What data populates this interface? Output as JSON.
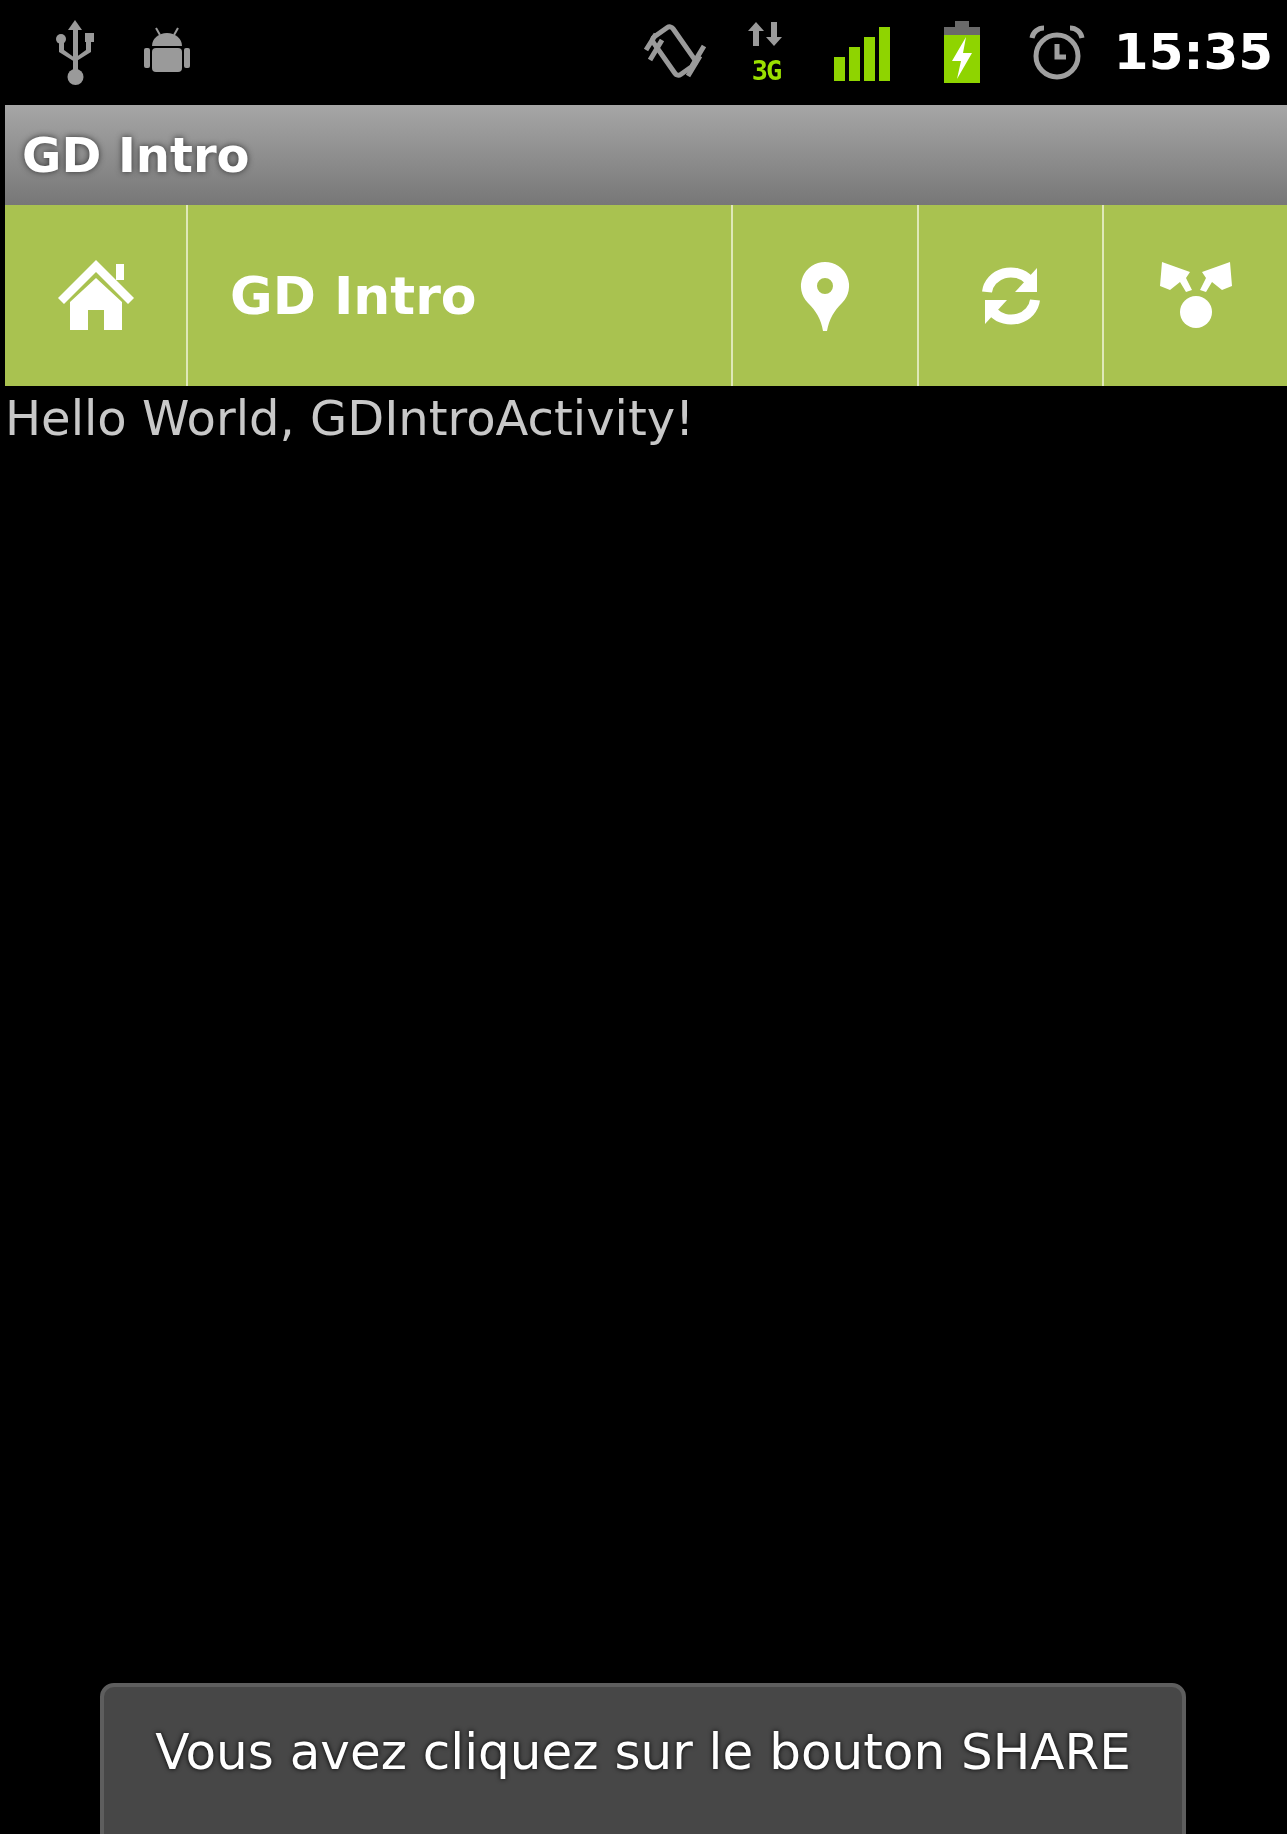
{
  "status_bar": {
    "network_type": "3G",
    "time": "15:35"
  },
  "window": {
    "title": "GD Intro"
  },
  "action_bar": {
    "items": [
      {
        "kind": "home"
      },
      {
        "kind": "title",
        "label": "GD Intro"
      },
      {
        "kind": "location"
      },
      {
        "kind": "refresh"
      },
      {
        "kind": "share"
      }
    ]
  },
  "content": {
    "text": "Hello World, GDIntroActivity!"
  },
  "toast": {
    "text": "Vous avez cliquez sur le bouton SHARE"
  }
}
